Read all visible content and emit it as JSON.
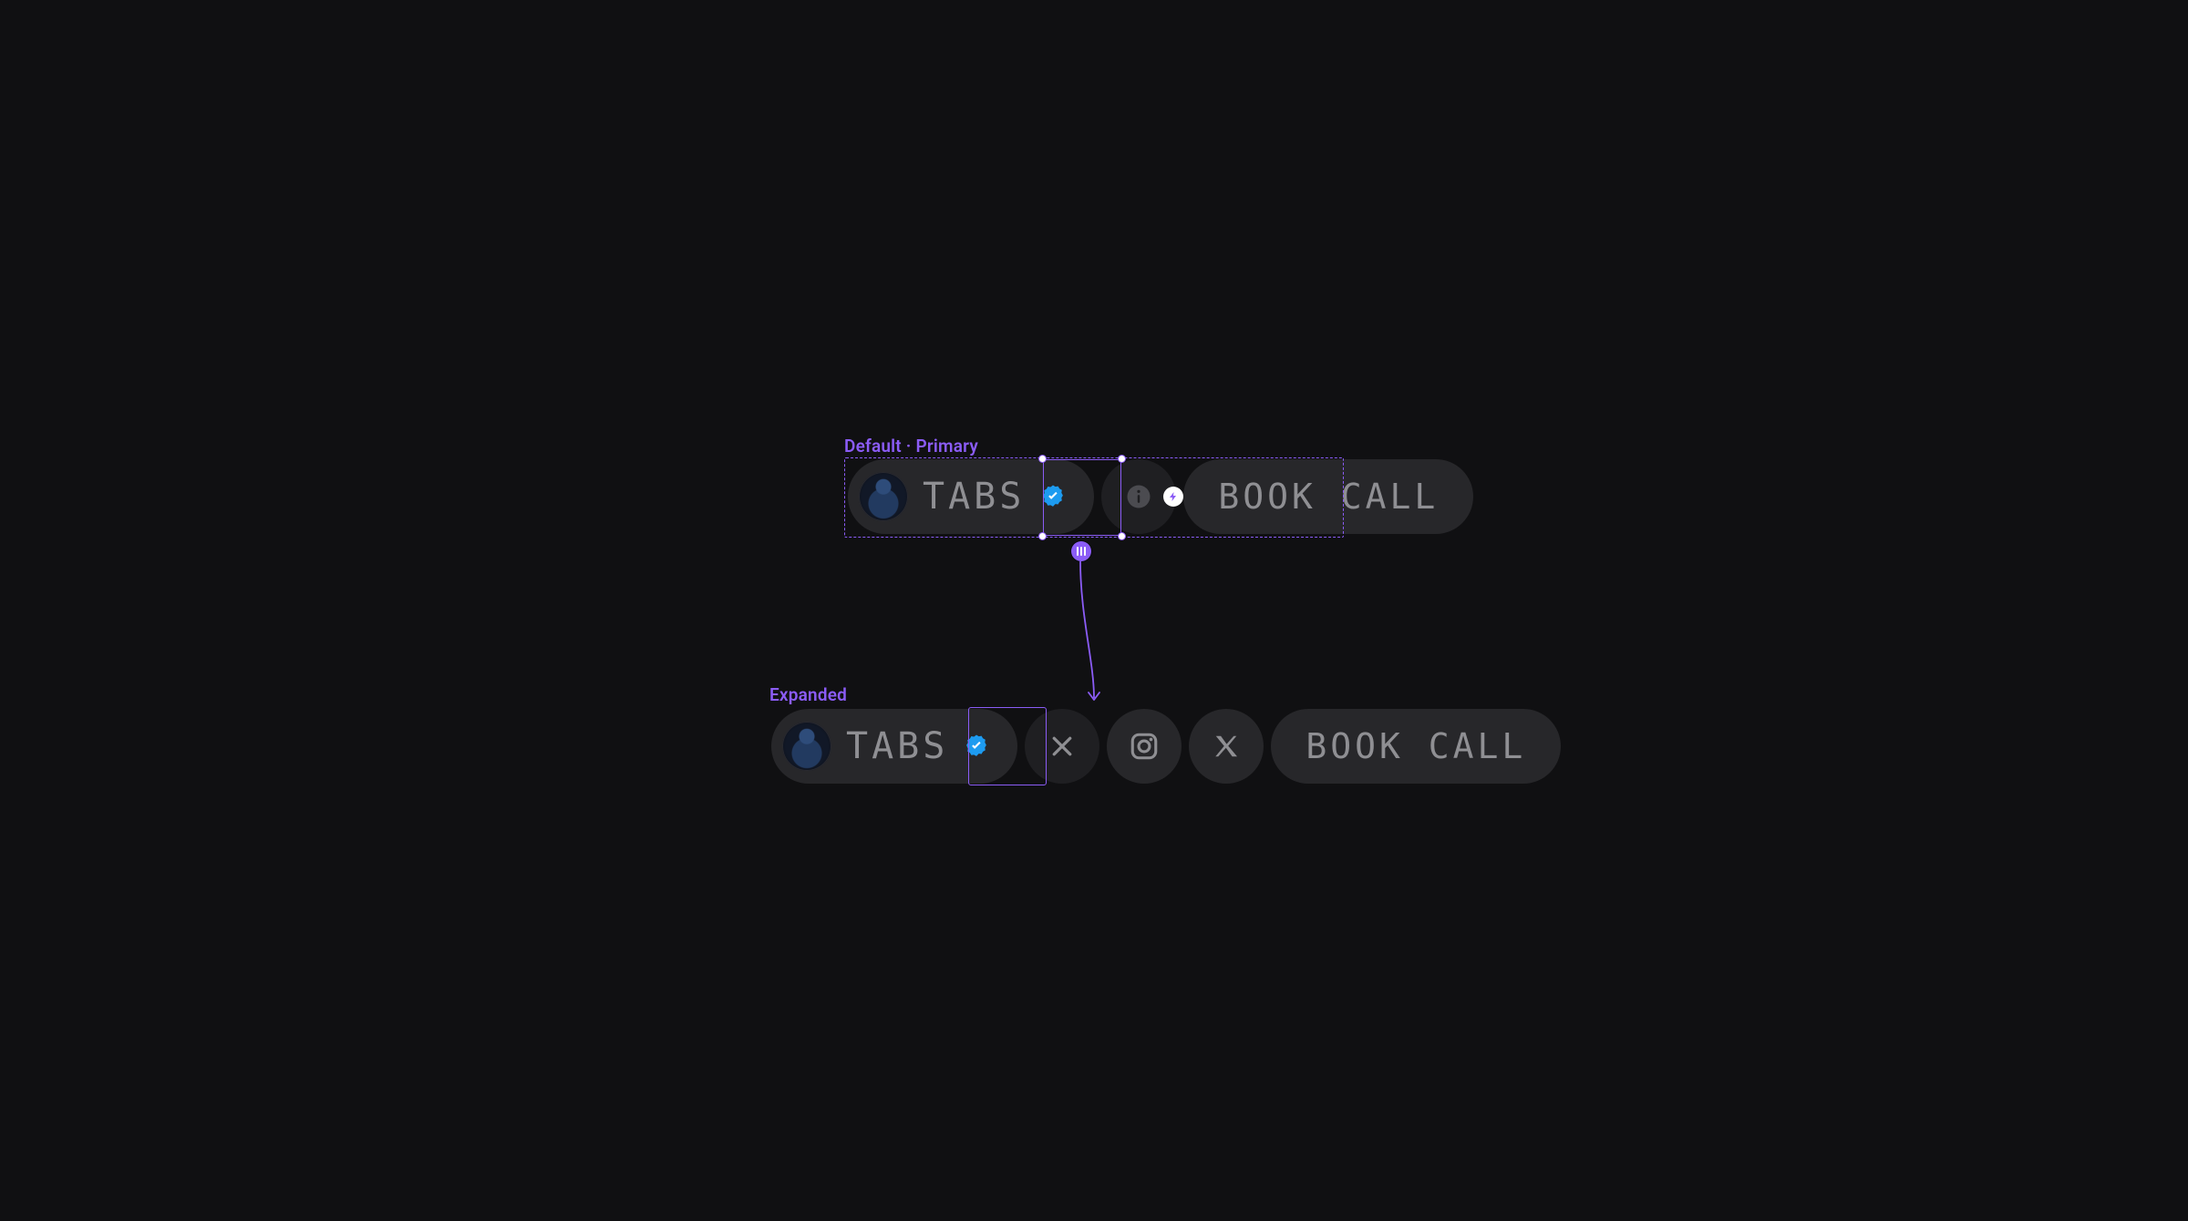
{
  "colors": {
    "background": "#101012",
    "pill": "#27272a",
    "pill_dark": "#1f1f22",
    "text_secondary": "#8f8f93",
    "accent_violet": "#8b5cf6",
    "verified_blue": "#1d9bf0"
  },
  "states": {
    "default": {
      "label": "Default · Primary",
      "tabs": {
        "name": "TABS",
        "verified": true,
        "avatar": "user-avatar"
      },
      "info": {
        "icon": "info-icon",
        "badge_icon": "lightning-icon"
      },
      "cta": {
        "label": "BOOK CALL"
      }
    },
    "expanded": {
      "label": "Expanded",
      "tabs": {
        "name": "TABS",
        "verified": true,
        "avatar": "user-avatar"
      },
      "actions": [
        {
          "icon": "close-icon"
        },
        {
          "icon": "instagram-icon"
        },
        {
          "icon": "x-twitter-icon"
        }
      ],
      "cta": {
        "label": "BOOK CALL"
      }
    }
  },
  "selection": {
    "outer_frame": "default-row",
    "inner_frame": "info-button",
    "interaction_badge": "interaction-handle",
    "arrow_target": "expanded-close-button"
  }
}
